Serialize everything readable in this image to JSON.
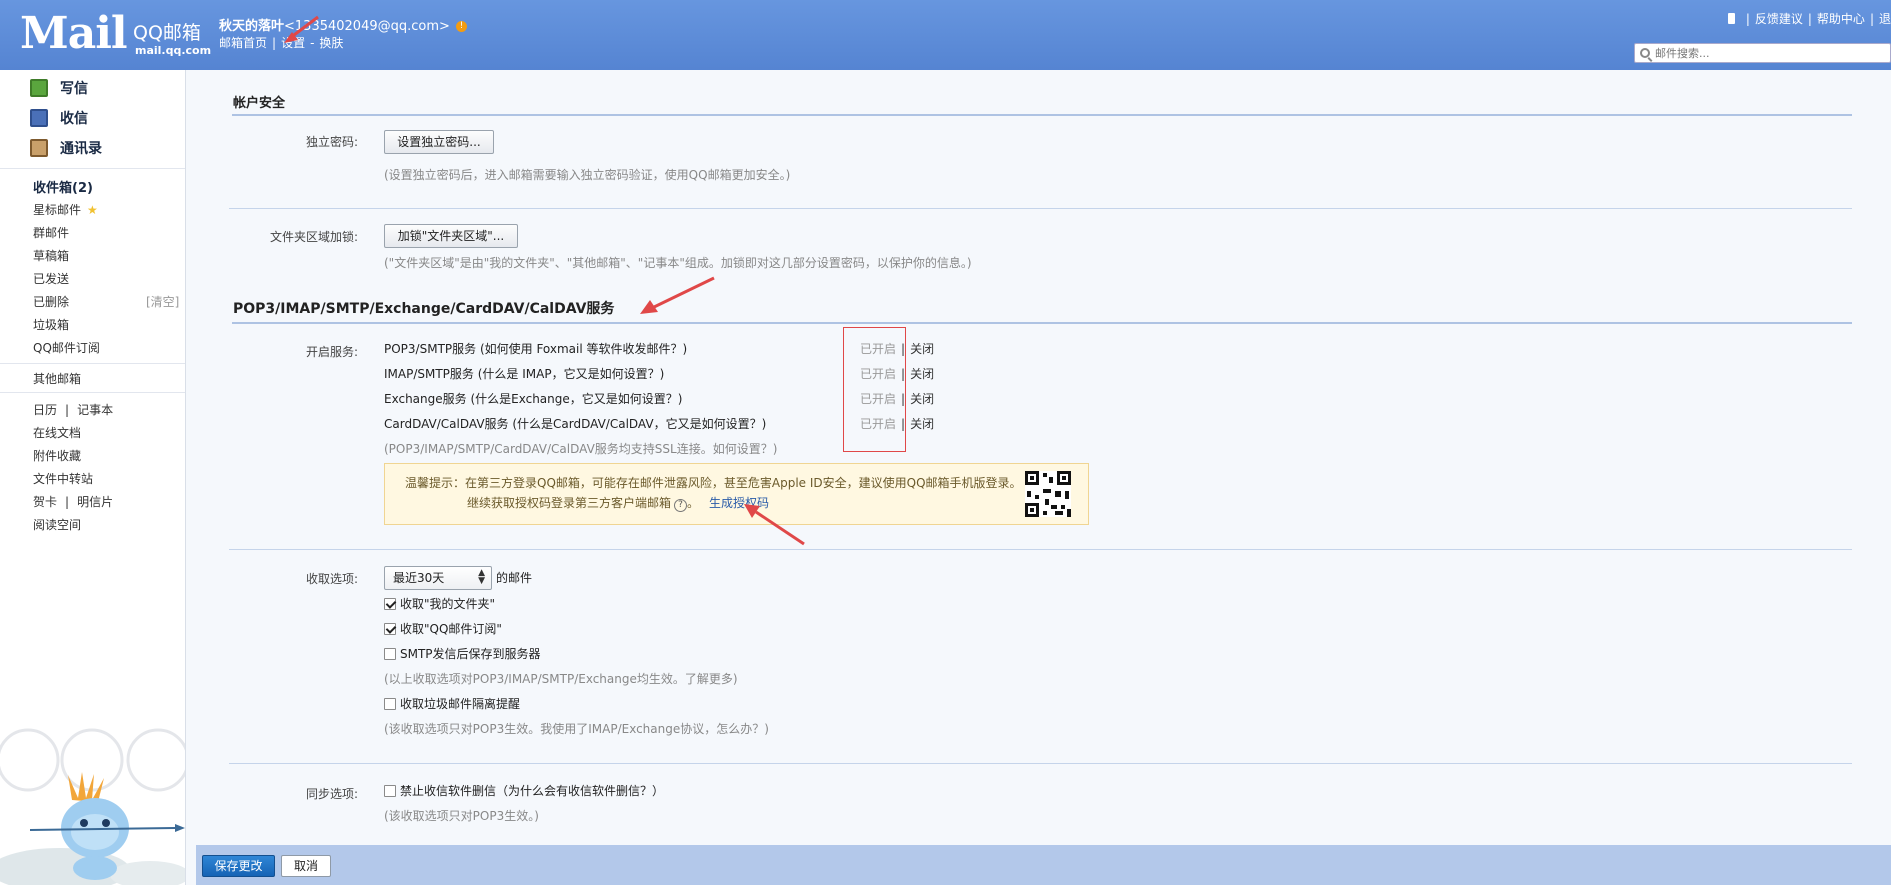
{
  "header": {
    "logo_text": "Mail",
    "logo_brand": "QQ邮箱",
    "logo_domain": "mail.qq.com",
    "user_name": "秋天的落叶",
    "user_email": "<1335402049@qq.com>",
    "nav": [
      "邮箱首页",
      "设置",
      "换肤"
    ],
    "top_links": [
      "反馈建议",
      "帮助中心",
      "退"
    ],
    "search_placeholder": "邮件搜索..."
  },
  "sidebar": {
    "primary": [
      "写信",
      "收信",
      "通讯录"
    ],
    "folders": [
      "收件箱(2)",
      "星标邮件",
      "群邮件",
      "草稿箱",
      "已发送",
      "已删除",
      "垃圾箱",
      "QQ邮件订阅"
    ],
    "clear_label": "[清空]",
    "other_mail": "其他邮箱",
    "tools": {
      "calendar": "日历",
      "notes": "记事本",
      "online_docs": "在线文档",
      "attachments": "附件收藏",
      "file_transfer": "文件中转站",
      "greeting_card": "贺卡",
      "postcard": "明信片",
      "reading": "阅读空间"
    }
  },
  "account_security": {
    "title": "帐户安全",
    "independent_password_label": "独立密码:",
    "independent_password_button": "设置独立密码...",
    "independent_password_hint": "(设置独立密码后，进入邮箱需要输入独立密码验证，使用QQ邮箱更加安全。)",
    "folder_lock_label": "文件夹区域加锁:",
    "folder_lock_button": "加锁\"文件夹区域\"...",
    "folder_lock_hint": "(\"文件夹区域\"是由\"我的文件夹\"、\"其他邮箱\"、\"记事本\"组成。加锁即对这几部分设置密码，以保护你的信息。)"
  },
  "protocols": {
    "title": "POP3/IMAP/SMTP/Exchange/CardDAV/CalDAV服务",
    "services_label": "开启服务:",
    "services": [
      {
        "name": "POP3/SMTP服务 (如何使用 Foxmail 等软件收发邮件？)",
        "status": "已开启",
        "action": "关闭"
      },
      {
        "name": "IMAP/SMTP服务 (什么是 IMAP，它又是如何设置？)",
        "status": "已开启",
        "action": "关闭"
      },
      {
        "name": "Exchange服务 (什么是Exchange，它又是如何设置？)",
        "status": "已开启",
        "action": "关闭"
      },
      {
        "name": "CardDAV/CalDAV服务 (什么是CardDAV/CalDAV，它又是如何设置？)",
        "status": "已开启",
        "action": "关闭"
      }
    ],
    "ssl_hint": "(POP3/IMAP/SMTP/CardDAV/CalDAV服务均支持SSL连接。如何设置？)",
    "tip_line1": "温馨提示：在第三方登录QQ邮箱，可能存在邮件泄露风险，甚至危害Apple ID安全，建议使用QQ邮箱手机版登录。",
    "tip_line2": "继续获取授权码登录第三方客户端邮箱",
    "tip_qmark": "?",
    "generate_code": "生成授权码"
  },
  "receive": {
    "label": "收取选项:",
    "range_value": "最近30天",
    "range_suffix": "的邮件",
    "options": [
      {
        "label": "收取\"我的文件夹\"",
        "checked": true
      },
      {
        "label": "收取\"QQ邮件订阅\"",
        "checked": true
      },
      {
        "label": "SMTP发信后保存到服务器",
        "checked": false
      }
    ],
    "options_hint": "(以上收取选项对POP3/IMAP/SMTP/Exchange均生效。了解更多)",
    "junk_label": "收取垃圾邮件隔离提醒",
    "junk_checked": false,
    "junk_hint": "(该收取选项只对POP3生效。我使用了IMAP/Exchange协议，怎么办？)"
  },
  "sync": {
    "label": "同步选项:",
    "option": "禁止收信软件删信（为什么会有收信软件删信？）",
    "checked": false,
    "hint": "(该收取选项只对POP3生效。)"
  },
  "footer": {
    "save": "保存更改",
    "cancel": "取消"
  },
  "colors": {
    "header": "#5b8bd6",
    "annotation": "#e04848",
    "save_button": "#1e6fc3"
  }
}
